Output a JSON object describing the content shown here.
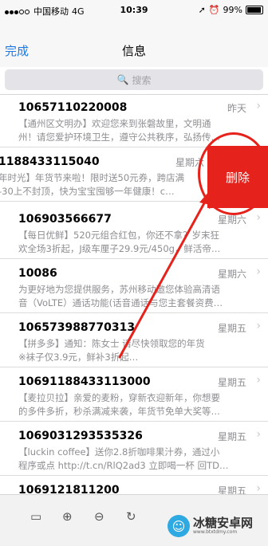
{
  "status": {
    "carrier": "中国移动",
    "network": "4G",
    "time": "10:39",
    "battery": "99%"
  },
  "nav": {
    "done": "完成",
    "title": "信息"
  },
  "search": {
    "placeholder": "搜索"
  },
  "messages": [
    {
      "number": "10657110220008",
      "time": "昨天",
      "preview1": "【通州区文明办】欢迎您来到张磐故里，文明通",
      "preview2": "州！请您爱护环境卫生，遵守公共秩序，弘扬传…"
    },
    {
      "number": "1188433115040",
      "time": "星期六",
      "preview1": "年时光】年货节来啦！限时送50元券，跨店满",
      "preview2": "-30上不封顶，快为宝宝囤够一年健康！c…"
    },
    {
      "number": "106903566677",
      "time": "星期六",
      "preview1": "【每日优鲜】520元组合红包，你还不拿？岁末狂",
      "preview2": "欢全场3折起，J级车厘子29.9元/450g，鲜活帝…"
    },
    {
      "number": "10086",
      "time": "星期六",
      "preview1": "为更好地为您提供服务，苏州移动邀您体验高清语",
      "preview2": "音（VoLTE）通话功能(话音通话与您主套餐资费…"
    },
    {
      "number": "106573988770313",
      "time": "星期五",
      "preview1": "【拼多多】通知：陈女士 请尽快领取您的年货",
      "preview2": "※袜子仅3.9元，鲜补3折起…"
    },
    {
      "number": "10691188433113000",
      "time": "星期五",
      "preview1": "【麦拉贝拉】亲爱的麦粉，穿新衣迎新年，你想要",
      "preview2": "的多件多折，秒杀满减来袭，年货节免单大奖等…"
    },
    {
      "number": "1069031293535326",
      "time": "星期五",
      "preview1": "【luckin coffee】送你2.8折咖啡果汁券，通过小",
      "preview2": "程序或点 http://t.cn/RlQ2ad3 立即喝一杯 回TD…"
    },
    {
      "number": "1069121811200",
      "time": "星期五",
      "preview1": "",
      "preview2": ""
    }
  ],
  "delete_label": "删除",
  "watermark": {
    "brand": "冰糖安卓网",
    "url": "www.btxtdmy.com"
  }
}
